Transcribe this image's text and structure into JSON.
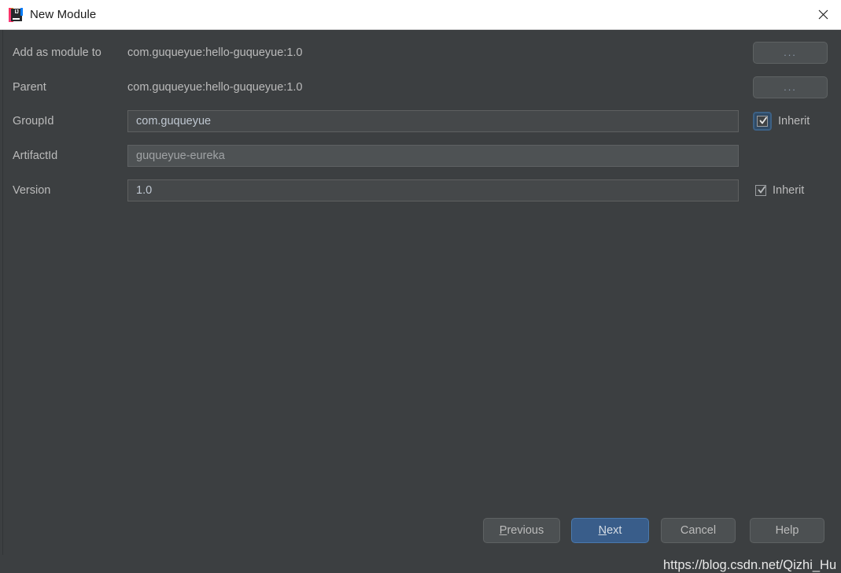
{
  "window": {
    "title": "New Module",
    "app_icon": "intellij-idea-icon",
    "icon_text": "IJ",
    "close_icon": "close-icon"
  },
  "form": {
    "rows": [
      {
        "label": "Add as module to",
        "kind": "static",
        "value": "com.guqueyue:hello-guqueyue:1.0",
        "button": "...",
        "name": "add-as-module-to"
      },
      {
        "label": "Parent",
        "kind": "static",
        "value": "com.guqueyue:hello-guqueyue:1.0",
        "button": "...",
        "name": "parent"
      },
      {
        "label": "GroupId",
        "kind": "input",
        "value": "com.guqueyue",
        "placeholder": "",
        "disabled": false,
        "inherit": "Inherit",
        "inherit_checked": true,
        "inherit_focused": true,
        "name": "group-id"
      },
      {
        "label": "ArtifactId",
        "kind": "input",
        "value": "guqueyue-eureka",
        "placeholder": "",
        "disabled": true,
        "inherit": null,
        "name": "artifact-id"
      },
      {
        "label": "Version",
        "kind": "input",
        "value": "1.0",
        "placeholder": "",
        "disabled": false,
        "inherit": "Inherit",
        "inherit_checked": true,
        "inherit_focused": false,
        "name": "version"
      }
    ]
  },
  "footer": {
    "previous": "Previous",
    "previous_mnemonic": "P",
    "previous_rest": "revious",
    "next": "Next",
    "next_mnemonic": "N",
    "next_rest": "ext",
    "cancel": "Cancel",
    "help": "Help"
  },
  "watermark": "https://blog.csdn.net/Qizhi_Hu",
  "colors": {
    "background": "#3c3f41",
    "titlebar": "#ffffff",
    "accent": "#395d8a",
    "focus_ring": "#3d6185",
    "label_text": "#bbbbbb",
    "field_background": "#45484a",
    "field_disabled_background": "#4e5254"
  }
}
